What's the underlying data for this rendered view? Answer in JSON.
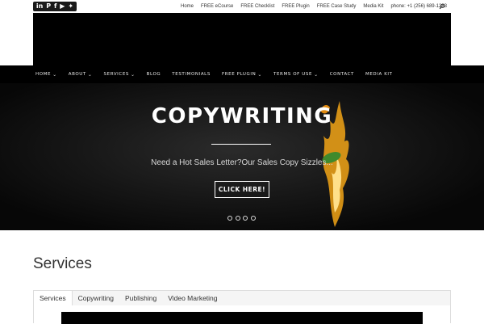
{
  "topbar": {
    "social": [
      {
        "icon": "linkedin-icon",
        "glyph": "in"
      },
      {
        "icon": "pinterest-icon",
        "glyph": "P"
      },
      {
        "icon": "facebook-icon",
        "glyph": "f"
      },
      {
        "icon": "youtube-icon",
        "glyph": "▶"
      },
      {
        "icon": "twitter-icon",
        "glyph": "✦"
      }
    ],
    "links": [
      "Home",
      "FREE eCourse",
      "FREE Checklist",
      "FREE Plugin",
      "FREE Case Study",
      "Media Kit",
      "phone: +1 (256) 689-1283"
    ],
    "search_icon": "search-icon"
  },
  "nav": {
    "items": [
      {
        "label": "HOME",
        "dropdown": true
      },
      {
        "label": "ABOUT",
        "dropdown": true
      },
      {
        "label": "SERVICES",
        "dropdown": true
      },
      {
        "label": "BLOG",
        "dropdown": false
      },
      {
        "label": "TESTIMONIALS",
        "dropdown": false
      },
      {
        "label": "FREE PLUGIN",
        "dropdown": true
      },
      {
        "label": "TERMS OF USE",
        "dropdown": true
      },
      {
        "label": "CONTACT",
        "dropdown": false
      },
      {
        "label": "MEDIA KIT",
        "dropdown": false
      }
    ],
    "chevron": "⌄"
  },
  "hero": {
    "title": "COPYWRITING",
    "subtitle": "Need a Hot Sales Letter?Our Sales Copy Sizzles...",
    "button": "CLICK HERE!",
    "slide_count": 4
  },
  "services": {
    "title": "Services",
    "tabs": [
      "Services",
      "Copywriting",
      "Publishing",
      "Video Marketing"
    ],
    "active_tab": 0
  },
  "colors": {
    "nav_bg": "#000000",
    "hero_text": "#ffffff",
    "flame": "#f2a516"
  }
}
